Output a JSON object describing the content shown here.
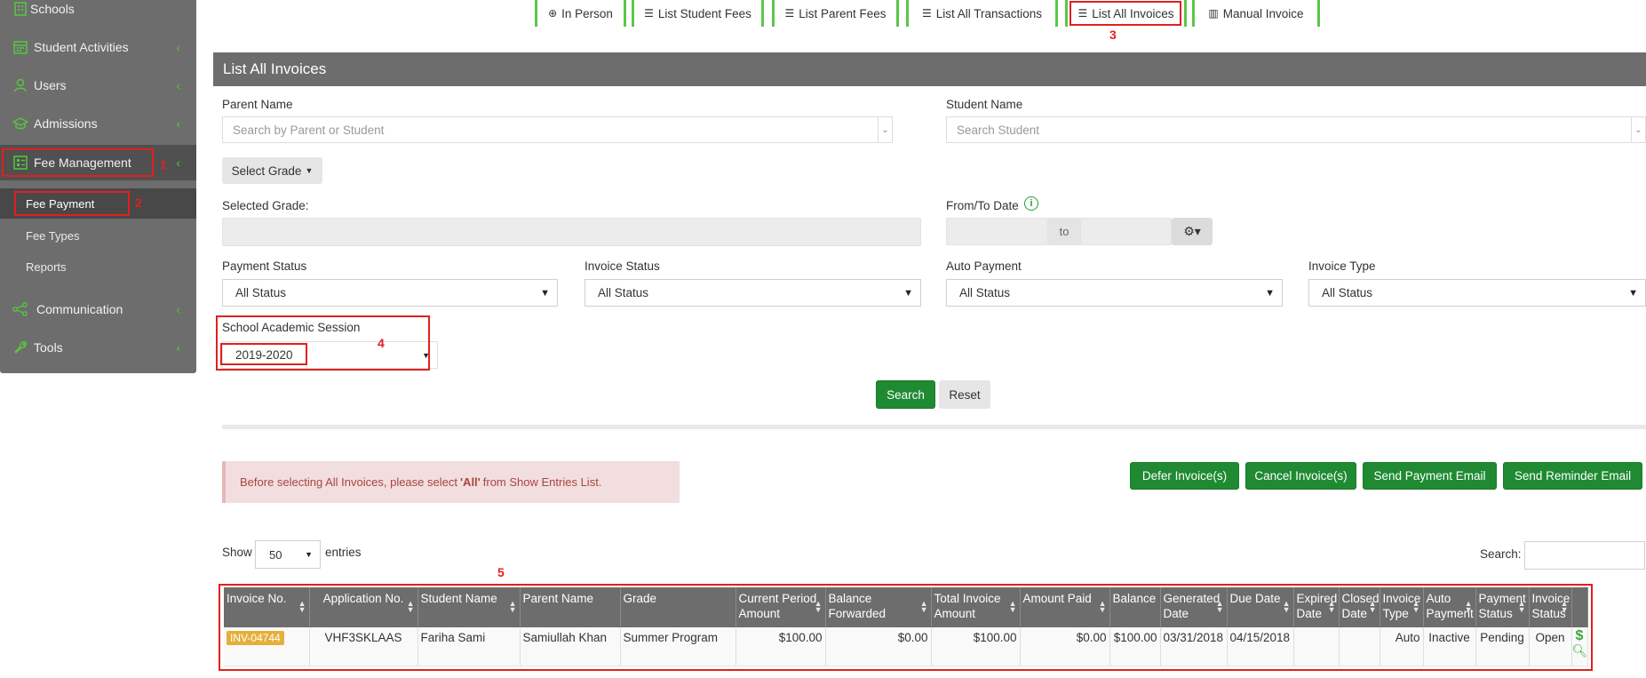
{
  "sidebar": {
    "items": [
      {
        "label": "Schools",
        "icon": "building-icon"
      },
      {
        "label": "Student Activities",
        "icon": "calendar-icon"
      },
      {
        "label": "Users",
        "icon": "user-icon"
      },
      {
        "label": "Admissions",
        "icon": "graduation-cap-icon"
      },
      {
        "label": "Fee Management",
        "icon": "list-icon"
      },
      {
        "label": "Communication",
        "icon": "share-icon"
      },
      {
        "label": "Tools",
        "icon": "wrench-icon"
      }
    ],
    "subitems": [
      {
        "label": "Fee Payment"
      },
      {
        "label": "Fee Types"
      },
      {
        "label": "Reports"
      }
    ],
    "chevron": "‹"
  },
  "annotations": [
    "1",
    "2",
    "3",
    "4",
    "5"
  ],
  "tabs": [
    {
      "label": "In Person",
      "icon": "plus-circle-icon"
    },
    {
      "label": "List Student Fees",
      "icon": "list-icon"
    },
    {
      "label": "List Parent Fees",
      "icon": "list-icon"
    },
    {
      "label": "List All Transactions",
      "icon": "list-icon"
    },
    {
      "label": "List All Invoices",
      "icon": "list-icon"
    },
    {
      "label": "Manual Invoice",
      "icon": "bar-chart-icon"
    }
  ],
  "panel": {
    "title": "List All Invoices",
    "parent_name_label": "Parent Name",
    "parent_placeholder": "Search by Parent or Student",
    "student_name_label": "Student Name",
    "student_placeholder": "Search Student",
    "select_grade": "Select Grade",
    "selected_grade_label": "Selected Grade:",
    "date_label": "From/To Date",
    "date_to": "to",
    "filters": [
      {
        "label": "Payment Status",
        "value": "All Status"
      },
      {
        "label": "Invoice Status",
        "value": "All Status"
      },
      {
        "label": "Auto Payment",
        "value": "All Status"
      },
      {
        "label": "Invoice Type",
        "value": "All Status"
      }
    ],
    "session_label": "School Academic Session",
    "session_value": "2019-2020",
    "search_btn": "Search",
    "reset_btn": "Reset"
  },
  "alert": {
    "before": "Before selecting All Invoices, please select",
    "bold": "'All'",
    "after": "from Show Entries List."
  },
  "actions": [
    "Defer Invoice(s)",
    "Cancel Invoice(s)",
    "Send Payment Email",
    "Send Reminder Email"
  ],
  "entries": {
    "show": "Show",
    "value": "50",
    "suffix": "entries",
    "search": "Search:"
  },
  "table": {
    "headers": [
      "Invoice No.",
      "Application No.",
      "Student Name",
      "Parent Name",
      "Grade",
      "Current Period Amount",
      "Balance Forwarded",
      "Total Invoice Amount",
      "Amount Paid",
      "Balance",
      "Generated Date",
      "Due Date",
      "Expired Date",
      "Closed Date",
      "Invoice Type",
      "Auto Payment",
      "Payment Status",
      "Invoice Status",
      ""
    ],
    "rows": [
      [
        "INV-04744",
        "VHF3SKLAAS",
        "Fariha Sami",
        "Samiullah Khan",
        "Summer Program",
        "$100.00",
        "$0.00",
        "$100.00",
        "$0.00",
        "$100.00",
        "03/31/2018",
        "04/15/2018",
        "",
        "",
        "Auto",
        "Inactive",
        "Pending",
        "Open",
        ""
      ]
    ]
  },
  "colors": {
    "accent_green": "#56c73e",
    "annotation_red": "#e02020",
    "panel_grey": "#6d6d6d"
  }
}
